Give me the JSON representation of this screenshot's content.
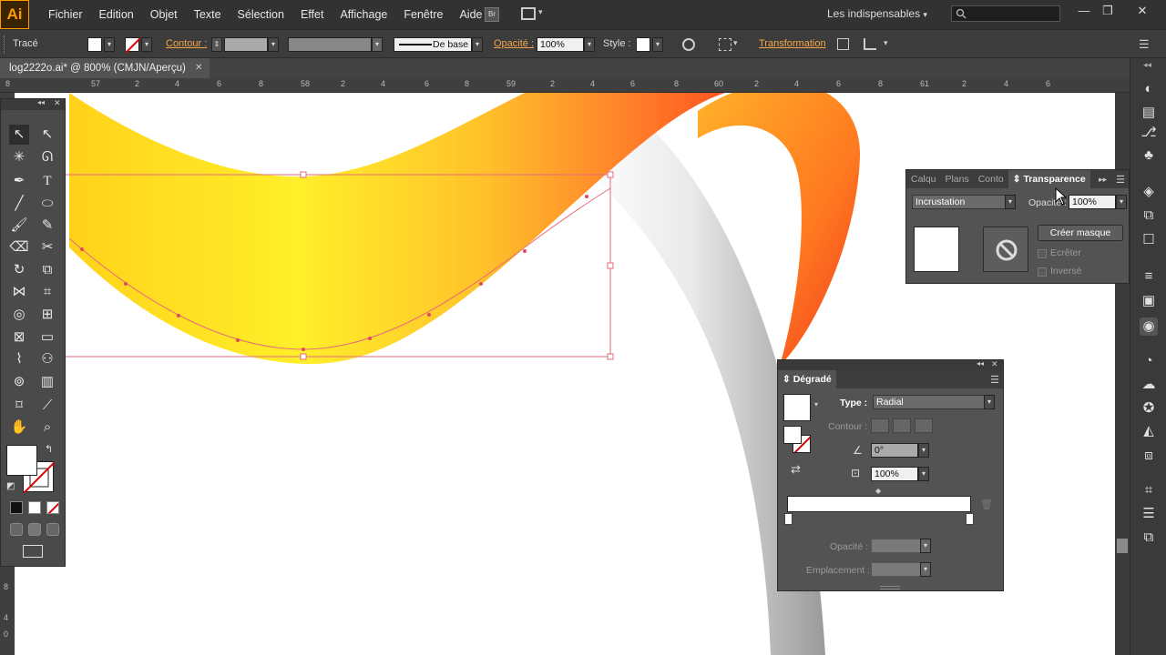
{
  "app": {
    "logo": "Ai"
  },
  "menu": [
    "Fichier",
    "Edition",
    "Objet",
    "Texte",
    "Sélection",
    "Effet",
    "Affichage",
    "Fenêtre",
    "Aide"
  ],
  "menu_extras": {
    "bridge": "Br",
    "workspace": "Les indispensables",
    "workspace_arrow": "▾"
  },
  "window_controls": {
    "minimize": "—",
    "restore": "❐",
    "close": "✕"
  },
  "control_bar": {
    "object_type": "Tracé",
    "stroke_label": "Contour :",
    "stroke_style": "De base",
    "opacity_label": "Opacité :",
    "opacity_value": "100%",
    "style_label": "Style :",
    "transform_label": "Transformation"
  },
  "document_tab": {
    "title": "log2222o.ai* @ 800% (CMJN/Aperçu)",
    "close": "✕"
  },
  "ruler_labels": [
    "8",
    "57",
    "2",
    "4",
    "6",
    "8",
    "58",
    "2",
    "4",
    "6",
    "8",
    "59",
    "2",
    "4",
    "6",
    "8",
    "60",
    "2",
    "4",
    "6",
    "8",
    "61",
    "2",
    "4",
    "6"
  ],
  "ruler_v_labels": [
    "8",
    "4",
    "0"
  ],
  "transparency_panel": {
    "tabs": [
      "Calqu",
      "Plans",
      "Conto",
      "Transparence"
    ],
    "blend_mode": "Incrustation",
    "opacity_label": "Opacité :",
    "opacity_value": "100%",
    "make_mask": "Créer masque",
    "clip_label": "Ecrêter",
    "invert_label": "Inversé"
  },
  "gradient_panel": {
    "title": "Dégradé",
    "type_label": "Type :",
    "type_value": "Radial",
    "stroke_label": "Contour :",
    "angle_value": "0°",
    "aspect_value": "100%",
    "opacity_label": "Opacité :",
    "location_label": "Emplacement :"
  },
  "colors": {
    "accent": "#f3a64a",
    "logo": "#ff9a00",
    "panel": "#535353",
    "canvas": "#ffffff"
  }
}
